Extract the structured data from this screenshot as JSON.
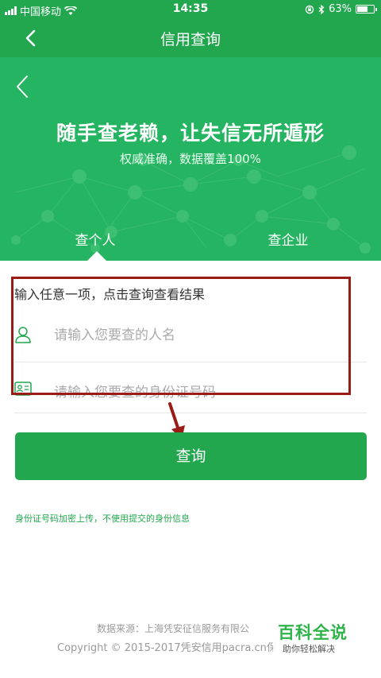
{
  "status_bar": {
    "carrier": "中国移动",
    "time": "14:35",
    "battery_percent": "63%",
    "battery_level": 0.63
  },
  "nav": {
    "title": "信用查询",
    "back_icon": "chevron-left-icon"
  },
  "banner": {
    "title": "随手查老赖，让失信无所遁形",
    "subtitle": "权威准确，数据覆盖100%",
    "background_color": "#25b461",
    "tabs": [
      {
        "label": "查个人",
        "selected": true
      },
      {
        "label": "查企业",
        "selected": false
      }
    ]
  },
  "form": {
    "hint": "输入任意一项，点击查询查看结果",
    "name_placeholder": "请输入您要查的人名",
    "id_placeholder": "请输入您要查的身份证号码"
  },
  "query_button": {
    "label": "查询"
  },
  "notice": "身份证号码加密上传，不使用提交的身份信息",
  "footer": {
    "source": "数据来源：上海凭安征信服务有限公",
    "copyright": "Copyright © 2015-2017凭安信用pacra.cn保"
  },
  "watermark": {
    "title": "百科全说",
    "subtitle": "助你轻松解决"
  },
  "colors": {
    "primary": "#22a74f",
    "annotation": "#9a1c16"
  }
}
